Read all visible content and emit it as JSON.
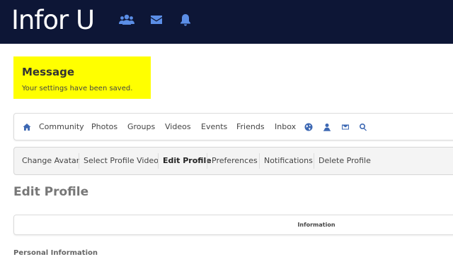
{
  "header": {
    "brand": "Infor U",
    "icons": [
      "users-icon",
      "envelope-icon",
      "bell-icon"
    ]
  },
  "message": {
    "title": "Message",
    "text": "Your settings have been saved.",
    "background": "#ffff00"
  },
  "community_nav": {
    "items": [
      {
        "icon": "home-icon"
      },
      {
        "label": "Community"
      },
      {
        "label": "Photos"
      },
      {
        "label": "Groups"
      },
      {
        "label": "Videos"
      },
      {
        "label": "Events"
      },
      {
        "label": "Friends"
      },
      {
        "label": "Inbox"
      },
      {
        "icon": "globe-icon"
      },
      {
        "icon": "user-icon"
      },
      {
        "icon": "envelope-icon"
      },
      {
        "icon": "search-icon"
      }
    ]
  },
  "profile_nav": {
    "tabs": [
      {
        "label": "Change Avatar"
      },
      {
        "label": "Select Profile Video"
      },
      {
        "label": "Edit Profile",
        "active": true
      },
      {
        "label": "Preferences"
      },
      {
        "label": "Notifications"
      },
      {
        "label": "Delete Profile"
      }
    ]
  },
  "page": {
    "title": "Edit Profile",
    "panel_label": "Information",
    "section_label": "Personal Information"
  },
  "colors": {
    "header_bg": "#0d1636",
    "icon_blue": "#5b8ee6",
    "nav_icon_blue": "#3d68b3"
  }
}
